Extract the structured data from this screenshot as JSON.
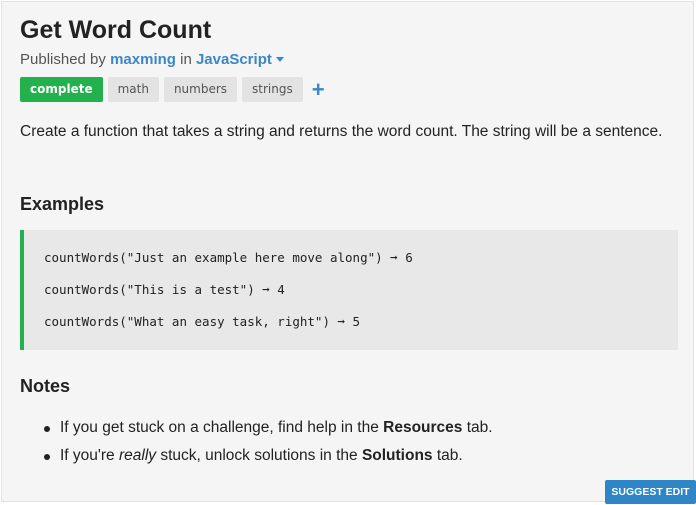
{
  "challenge": {
    "title": "Get Word Count",
    "published_by_prefix": "Published by",
    "author": "maxming",
    "in_word": "in",
    "language": "JavaScript"
  },
  "tags": {
    "status": "complete",
    "items": [
      "math",
      "numbers",
      "strings"
    ],
    "add_symbol": "+"
  },
  "description": "Create a function that takes a string and returns the word count. The string will be a sentence.",
  "examples": {
    "title": "Examples",
    "lines": [
      "countWords(\"Just an example here move along\") ➞ 6",
      "countWords(\"This is a test\") ➞ 4",
      "countWords(\"What an easy task, right\") ➞ 5"
    ]
  },
  "notes": {
    "title": "Notes",
    "items": [
      {
        "before": "If you get stuck on a challenge, find help in the ",
        "em": "",
        "bold": "Resources",
        "after": " tab."
      },
      {
        "before": "If you're ",
        "em": "really",
        "mid": " stuck, unlock solutions in the ",
        "bold": "Solutions",
        "after": " tab."
      }
    ]
  },
  "suggest_edit_label": "SUGGEST EDIT"
}
